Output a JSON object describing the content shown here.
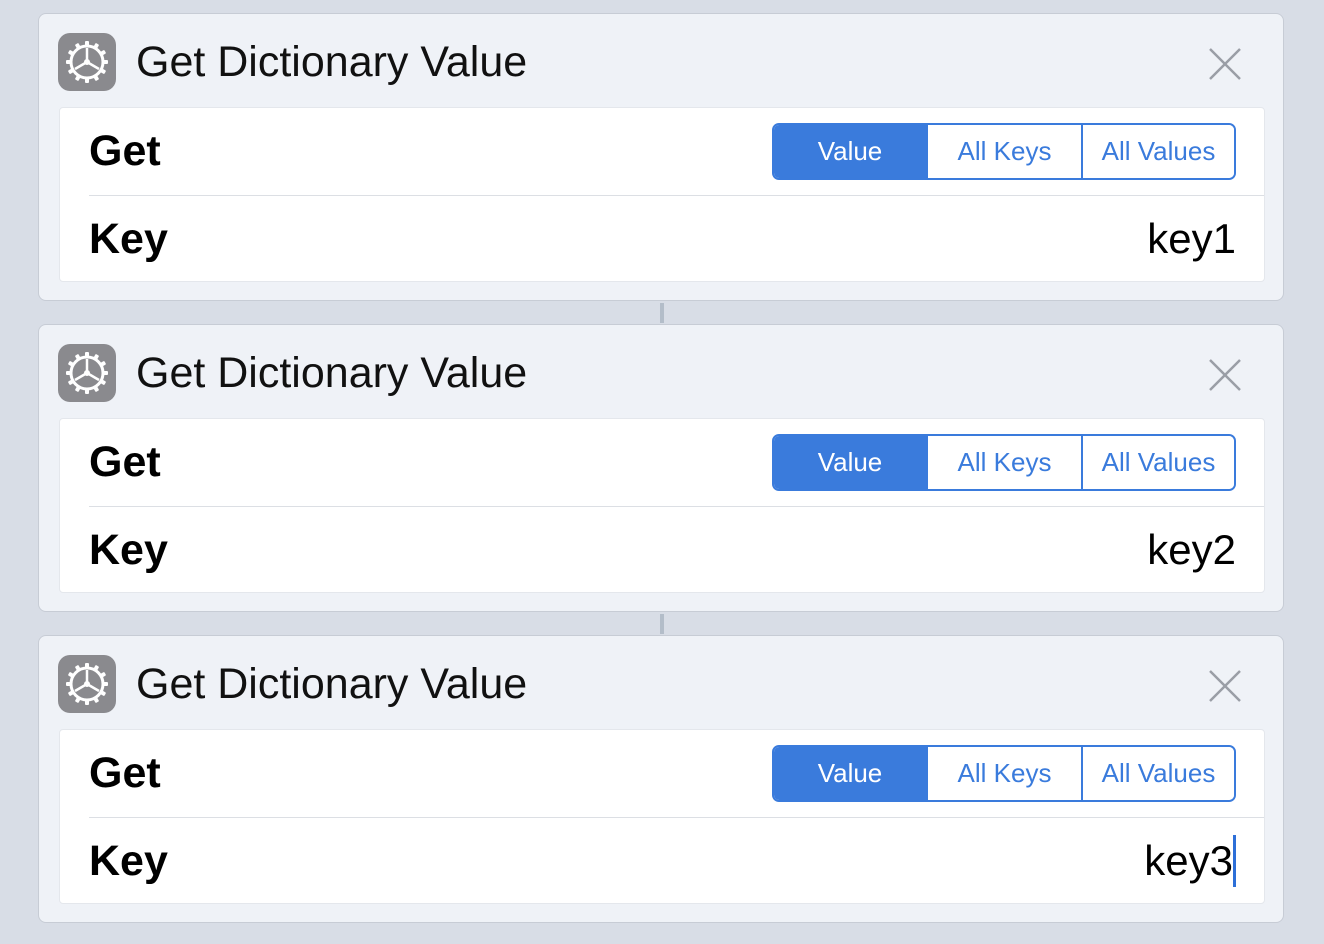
{
  "colors": {
    "accent": "#3a7bdc",
    "background": "#d8dde6",
    "card": "#eff2f7",
    "icon_gray": "#8a8a8e"
  },
  "actions": [
    {
      "icon": "gear-icon",
      "title": "Get Dictionary Value",
      "close_icon": "close-icon",
      "get_label": "Get",
      "segments": [
        "Value",
        "All Keys",
        "All Values"
      ],
      "selected_segment": "Value",
      "key_label": "Key",
      "key_value": "key1"
    },
    {
      "icon": "gear-icon",
      "title": "Get Dictionary Value",
      "close_icon": "close-icon",
      "get_label": "Get",
      "segments": [
        "Value",
        "All Keys",
        "All Values"
      ],
      "selected_segment": "Value",
      "key_label": "Key",
      "key_value": "key2"
    },
    {
      "icon": "gear-icon",
      "title": "Get Dictionary Value",
      "close_icon": "close-icon",
      "get_label": "Get",
      "segments": [
        "Value",
        "All Keys",
        "All Values"
      ],
      "selected_segment": "Value",
      "key_label": "Key",
      "key_value": "key3",
      "focused": true
    }
  ]
}
